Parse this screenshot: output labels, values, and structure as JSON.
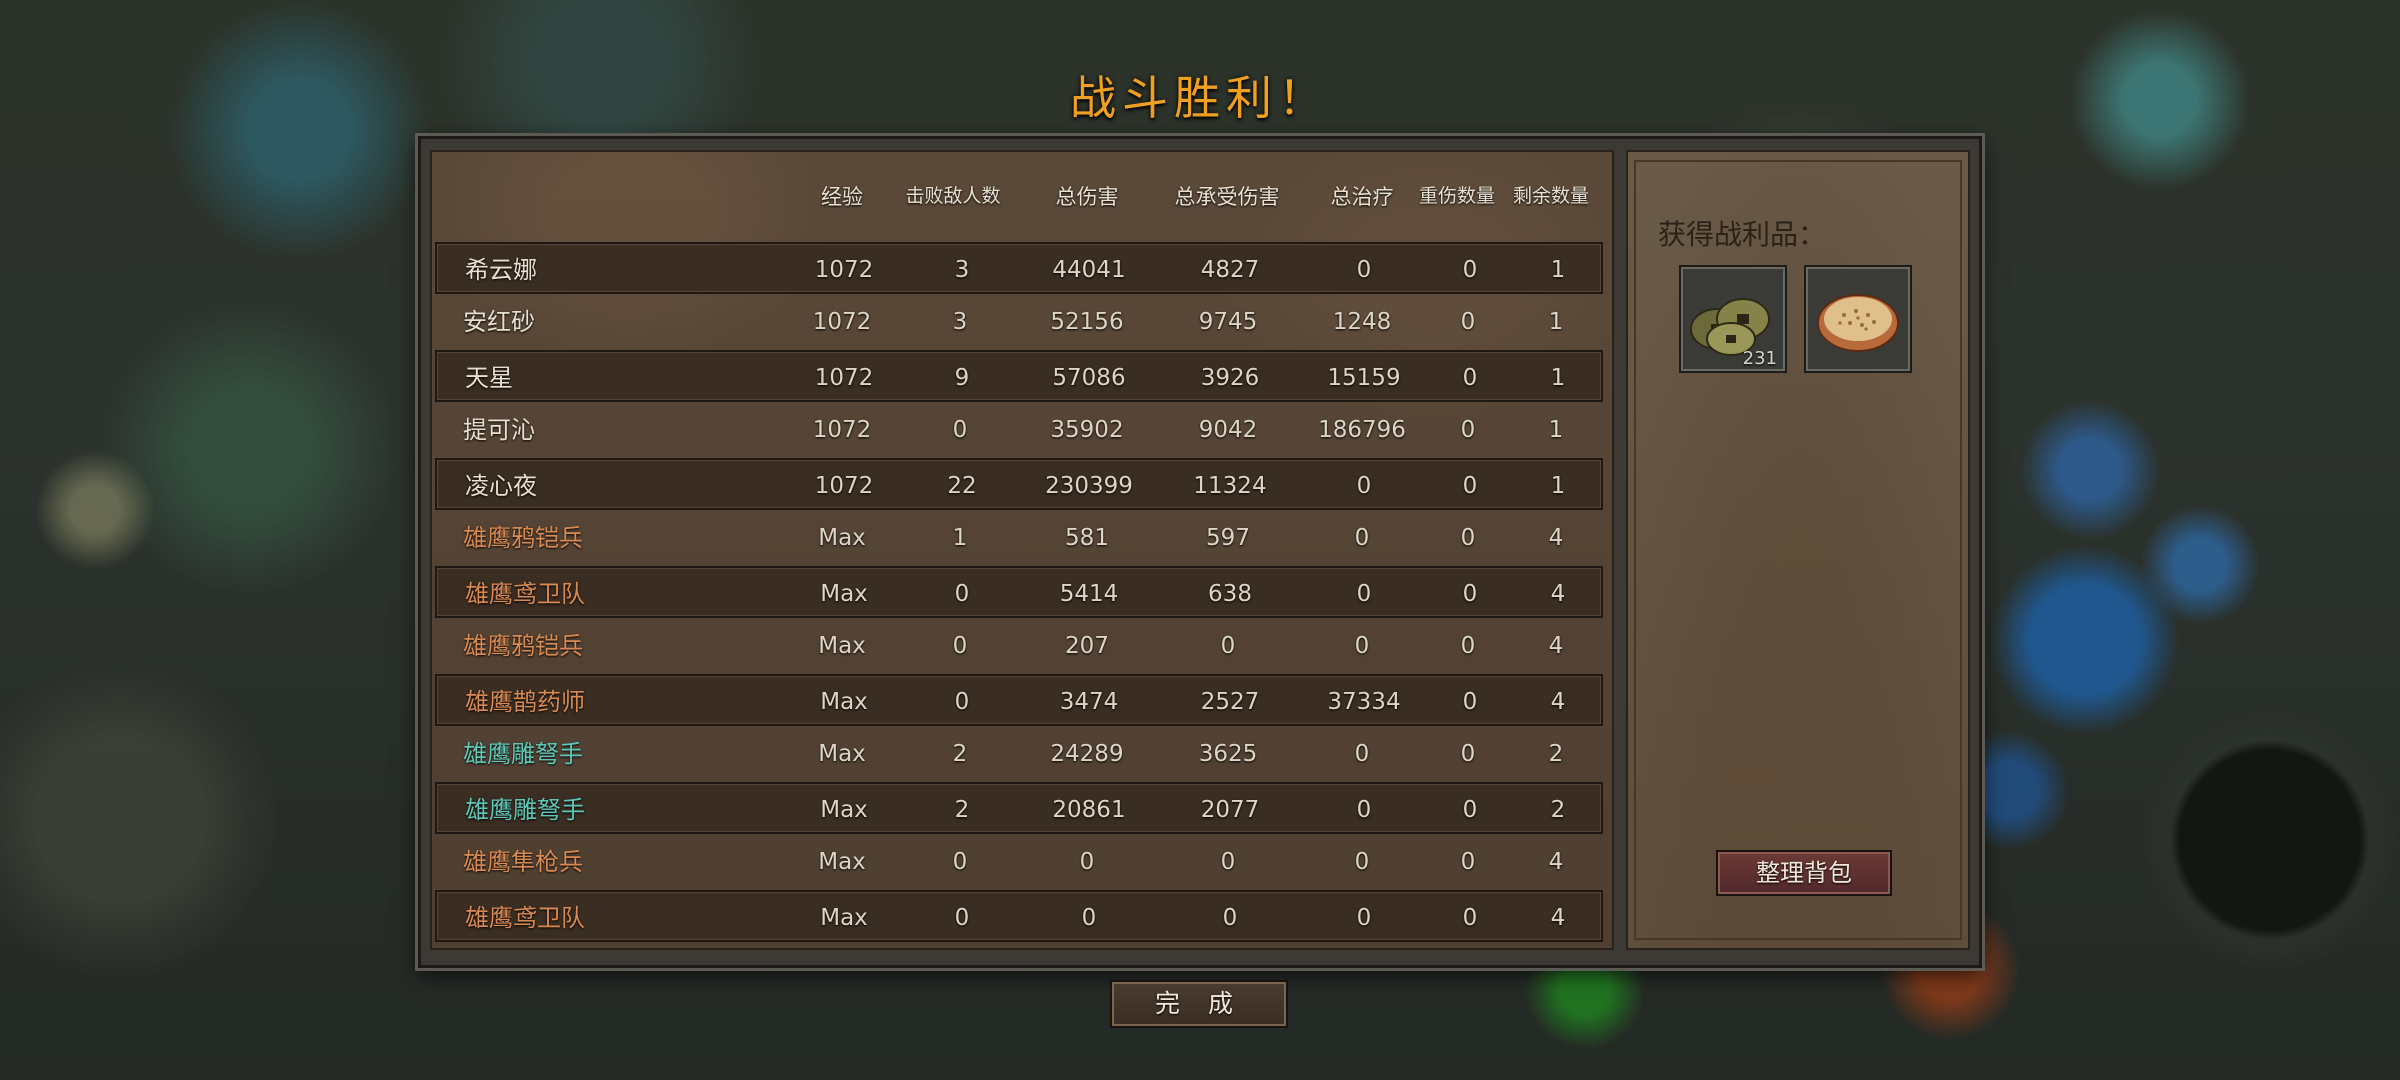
{
  "title": "战斗胜利！",
  "columns": [
    "经验",
    "击败敌人数",
    "总伤害",
    "总承受伤害",
    "总治疗",
    "重伤数量",
    "剩余数量"
  ],
  "rows": [
    {
      "name": "希云娜",
      "name_color": "#e8e0d0",
      "exp": "1072",
      "kills": "3",
      "damage": "44041",
      "taken": "4827",
      "heal": "0",
      "injured": "0",
      "remaining": "1"
    },
    {
      "name": "安红砂",
      "name_color": "#e8e0d0",
      "exp": "1072",
      "kills": "3",
      "damage": "52156",
      "taken": "9745",
      "heal": "1248",
      "injured": "0",
      "remaining": "1"
    },
    {
      "name": "天星",
      "name_color": "#e8e0d0",
      "exp": "1072",
      "kills": "9",
      "damage": "57086",
      "taken": "3926",
      "heal": "15159",
      "injured": "0",
      "remaining": "1"
    },
    {
      "name": "提可沁",
      "name_color": "#e8e0d0",
      "exp": "1072",
      "kills": "0",
      "damage": "35902",
      "taken": "9042",
      "heal": "186796",
      "injured": "0",
      "remaining": "1"
    },
    {
      "name": "凌心夜",
      "name_color": "#e8e0d0",
      "exp": "1072",
      "kills": "22",
      "damage": "230399",
      "taken": "11324",
      "heal": "0",
      "injured": "0",
      "remaining": "1"
    },
    {
      "name": "雄鹰鸦铠兵",
      "name_color": "#d98a52",
      "exp": "Max",
      "kills": "1",
      "damage": "581",
      "taken": "597",
      "heal": "0",
      "injured": "0",
      "remaining": "4"
    },
    {
      "name": "雄鹰鸢卫队",
      "name_color": "#d98a52",
      "exp": "Max",
      "kills": "0",
      "damage": "5414",
      "taken": "638",
      "heal": "0",
      "injured": "0",
      "remaining": "4"
    },
    {
      "name": "雄鹰鸦铠兵",
      "name_color": "#d98a52",
      "exp": "Max",
      "kills": "0",
      "damage": "207",
      "taken": "0",
      "heal": "0",
      "injured": "0",
      "remaining": "4"
    },
    {
      "name": "雄鹰鹊药师",
      "name_color": "#d98a52",
      "exp": "Max",
      "kills": "0",
      "damage": "3474",
      "taken": "2527",
      "heal": "37334",
      "injured": "0",
      "remaining": "4"
    },
    {
      "name": "雄鹰雕弩手",
      "name_color": "#5ec8b8",
      "exp": "Max",
      "kills": "2",
      "damage": "24289",
      "taken": "3625",
      "heal": "0",
      "injured": "0",
      "remaining": "2"
    },
    {
      "name": "雄鹰雕弩手",
      "name_color": "#5ec8b8",
      "exp": "Max",
      "kills": "2",
      "damage": "20861",
      "taken": "2077",
      "heal": "0",
      "injured": "0",
      "remaining": "2"
    },
    {
      "name": "雄鹰隼枪兵",
      "name_color": "#d98a52",
      "exp": "Max",
      "kills": "0",
      "damage": "0",
      "taken": "0",
      "heal": "0",
      "injured": "0",
      "remaining": "4"
    },
    {
      "name": "雄鹰鸢卫队",
      "name_color": "#d98a52",
      "exp": "Max",
      "kills": "0",
      "damage": "0",
      "taken": "0",
      "heal": "0",
      "injured": "0",
      "remaining": "4"
    }
  ],
  "loot": {
    "title": "获得战利品：",
    "items": [
      {
        "icon": "copper-coins-icon",
        "count": "231"
      },
      {
        "icon": "flatbread-icon",
        "count": ""
      }
    ],
    "sort_button": "整理背包"
  },
  "done_button": "完 成"
}
